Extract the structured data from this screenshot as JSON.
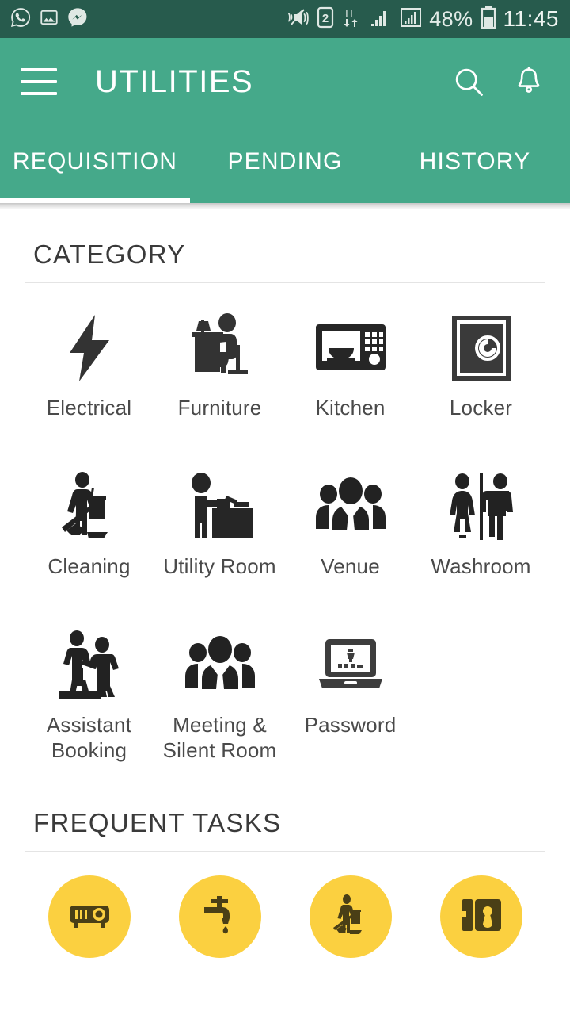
{
  "status_bar": {
    "left_icons": [
      "whatsapp-icon",
      "gallery-icon",
      "messenger-icon"
    ],
    "right_icons": [
      "vibrate-mute-icon",
      "sim2-icon",
      "hspa-data-icon",
      "signal-bars-icon",
      "signal-bars-boxed-icon"
    ],
    "sim_label": "2",
    "network_label": "H",
    "battery_percent": "48%",
    "time": "11:45",
    "background_color": "#275b4d",
    "text_color": "#dfe8e4"
  },
  "app_bar": {
    "menu_icon": "hamburger-menu-icon",
    "title": "UTILITIES",
    "search_icon": "search-icon",
    "notification_icon": "bell-icon",
    "background_color": "#45a98a",
    "text_color": "#ffffff"
  },
  "tabs": {
    "active_index": 0,
    "items": [
      {
        "label": "REQUISITION"
      },
      {
        "label": "PENDING"
      },
      {
        "label": "HISTORY"
      }
    ]
  },
  "category": {
    "title": "CATEGORY",
    "items": [
      {
        "label": "Electrical",
        "icon": "lightning-bolt-icon"
      },
      {
        "label": "Furniture",
        "icon": "person-at-desk-icon"
      },
      {
        "label": "Kitchen",
        "icon": "microwave-icon"
      },
      {
        "label": "Locker",
        "icon": "safe-locker-icon"
      },
      {
        "label": "Cleaning",
        "icon": "floor-cleaner-icon"
      },
      {
        "label": "Utility Room",
        "icon": "person-at-counter-icon"
      },
      {
        "label": "Venue",
        "icon": "people-group-icon"
      },
      {
        "label": "Washroom",
        "icon": "restroom-man-woman-icon"
      },
      {
        "label": "Assistant Booking",
        "icon": "handshake-assist-icon"
      },
      {
        "label": "Meeting & Silent Room",
        "icon": "people-group-icon"
      },
      {
        "label": "Password",
        "icon": "laptop-password-icon"
      }
    ]
  },
  "frequent_tasks": {
    "title": "FREQUENT TASKS",
    "circle_color": "#fbd040",
    "icon_color": "#4a3f16",
    "items": [
      {
        "icon": "projector-icon"
      },
      {
        "icon": "faucet-tap-icon"
      },
      {
        "icon": "floor-cleaner-icon"
      },
      {
        "icon": "locker-keyhole-icon"
      }
    ]
  }
}
